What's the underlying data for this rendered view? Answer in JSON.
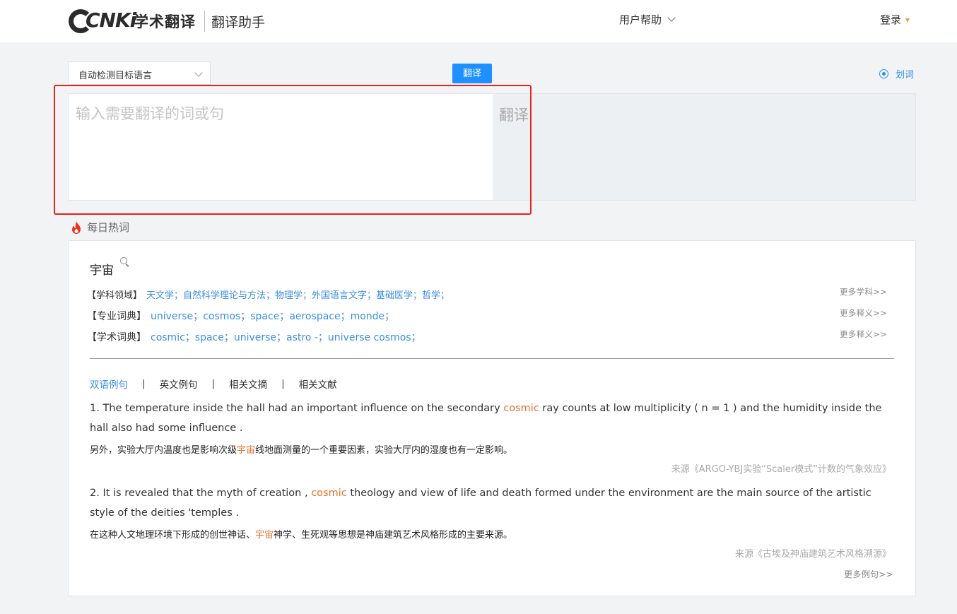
{
  "header": {
    "logo_mark": "CNKi",
    "logo_text": "学术翻译",
    "subtitle": "翻译助手",
    "help_label": "用户帮助",
    "login_label": "登录"
  },
  "controls": {
    "language_select": "自动检测目标语言",
    "translate_button": "翻译",
    "pick_word_label": "划词"
  },
  "panel": {
    "input_placeholder": "输入需要翻译的词或句",
    "input_value": "",
    "output_placeholder": "翻译"
  },
  "hot": {
    "title": "每日热词",
    "word": "宇宙",
    "rows": [
      {
        "label": "【学科领域】",
        "items": "天文学；自然科学理论与方法；物理学；外国语言文字；基础医学；哲学；",
        "more": "更多学科>>"
      },
      {
        "label": "【专业词典】",
        "items": "universe；cosmos；space；aerospace；monde；",
        "more": "更多释义>>"
      },
      {
        "label": "【学术词典】",
        "items": "cosmic；space；universe；astro -；universe cosmos；",
        "more": "更多释义>>"
      }
    ],
    "tabs": [
      "双语例句",
      "英文例句",
      "相关文摘",
      "相关文献"
    ],
    "active_tab": 0,
    "examples": [
      {
        "en_before": "1. The temperature inside the hall had an important influence on the secondary ",
        "en_hl": "cosmic",
        "en_after": " ray counts at low multiplicity ( n = 1 ) and the humidity inside the hall also had some influence .",
        "zh_before": "另外，实验大厅内温度也是影响次级",
        "zh_hl": "宇宙",
        "zh_after": "线地面测量的一个重要因素，实验大厅内的湿度也有一定影响。",
        "source": "来源《ARGO-YBJ实验“Scaler模式”计数的气象效应》"
      },
      {
        "en_before": "2. It is revealed that the myth of creation , ",
        "en_hl": "cosmic",
        "en_after": " theology and view of life and death formed under the environment are the main source of the artistic style of the deities 'temples .",
        "zh_before": "在这种人文地理环境下形成的创世神话、",
        "zh_hl": "宇宙",
        "zh_after": "神学、生死观等思想是神庙建筑艺术风格形成的主要来源。",
        "source": "来源《古埃及神庙建筑艺术风格溯源》"
      }
    ],
    "more_examples": "更多例句>>"
  },
  "colors": {
    "accent": "#1e90ff",
    "link": "#3a8ee6",
    "highlight": "#e8712f",
    "annotation": "#e8221c"
  }
}
